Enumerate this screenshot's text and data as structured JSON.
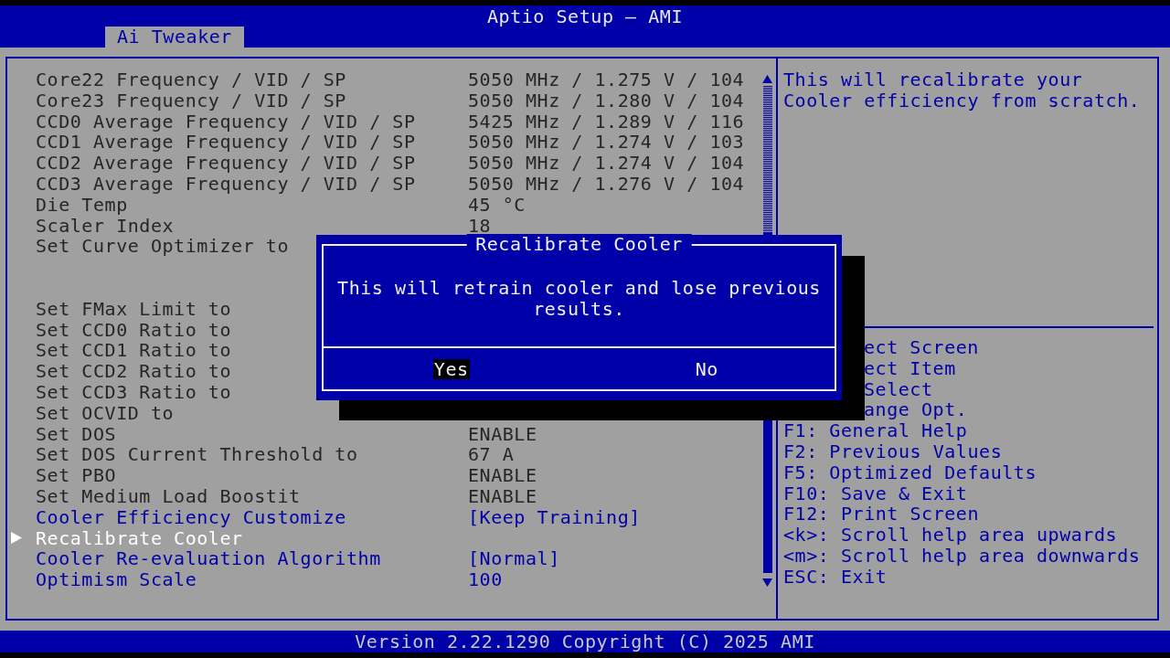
{
  "header": {
    "title": "Aptio Setup – AMI",
    "tabs": [
      {
        "label": "Ai Tweaker",
        "selected": true
      }
    ]
  },
  "rows": [
    {
      "kind": "info",
      "label": "Core22 Frequency / VID / SP",
      "value": "5050 MHz / 1.275 V / 104",
      "selected": false
    },
    {
      "kind": "info",
      "label": "Core23 Frequency / VID / SP",
      "value": "5050 MHz / 1.280 V / 104",
      "selected": false
    },
    {
      "kind": "info",
      "label": "CCD0 Average Frequency / VID / SP",
      "value": "5425 MHz / 1.289 V / 116",
      "selected": false
    },
    {
      "kind": "info",
      "label": "CCD1 Average Frequency / VID / SP",
      "value": "5050 MHz / 1.274 V / 103",
      "selected": false
    },
    {
      "kind": "info",
      "label": "CCD2 Average Frequency / VID / SP",
      "value": "5050 MHz / 1.274 V / 104",
      "selected": false
    },
    {
      "kind": "info",
      "label": "CCD3 Average Frequency / VID / SP",
      "value": "5050 MHz / 1.276 V / 104",
      "selected": false
    },
    {
      "kind": "info",
      "label": "Die Temp",
      "value": "45 °C",
      "selected": false
    },
    {
      "kind": "info",
      "label": "Scaler Index",
      "value": "18",
      "selected": false
    },
    {
      "kind": "info",
      "label": "Set Curve Optimizer to",
      "selected": false
    },
    {
      "kind": "spacer"
    },
    {
      "kind": "spacer"
    },
    {
      "kind": "info",
      "label": "Set FMax Limit to",
      "selected": false
    },
    {
      "kind": "info",
      "label": "Set CCD0 Ratio to",
      "selected": false
    },
    {
      "kind": "info",
      "label": "Set CCD1 Ratio to",
      "selected": false
    },
    {
      "kind": "info",
      "label": "Set CCD2 Ratio to",
      "selected": false
    },
    {
      "kind": "info",
      "label": "Set CCD3 Ratio to",
      "selected": false
    },
    {
      "kind": "info",
      "label": "Set OCVID to",
      "selected": false
    },
    {
      "kind": "info",
      "label": "Set DOS",
      "value": "ENABLE",
      "selected": false
    },
    {
      "kind": "info",
      "label": "Set DOS Current Threshold to",
      "value": "67 A",
      "selected": false
    },
    {
      "kind": "info",
      "label": "Set PBO",
      "value": "ENABLE",
      "selected": false
    },
    {
      "kind": "info",
      "label": "Set Medium Load Boostit",
      "value": "ENABLE",
      "selected": false
    },
    {
      "kind": "option",
      "label": "Cooler Efficiency Customize",
      "value": "[Keep Training]",
      "selected": false
    },
    {
      "kind": "option",
      "label": "Recalibrate Cooler",
      "selected": true
    },
    {
      "kind": "option",
      "label": "Cooler Re-evaluation Algorithm",
      "value": "[Normal]",
      "selected": false
    },
    {
      "kind": "option",
      "label": "Optimism Scale",
      "value": "100",
      "selected": false
    }
  ],
  "help": {
    "lines": [
      "This will recalibrate your",
      "Cooler efficiency from scratch."
    ]
  },
  "keys": [
    {
      "kind": "partial",
      "text": "ect Screen"
    },
    {
      "kind": "partial",
      "text": "ect Item"
    },
    {
      "kind": "partial",
      "text": "Select"
    },
    {
      "kind": "partial",
      "text": "ange Opt."
    },
    {
      "kind": "full",
      "text": "F1: General Help"
    },
    {
      "kind": "full",
      "text": "F2: Previous Values"
    },
    {
      "kind": "full",
      "text": "F5: Optimized Defaults"
    },
    {
      "kind": "full",
      "text": "F10: Save & Exit"
    },
    {
      "kind": "full",
      "text": "F12: Print Screen"
    },
    {
      "kind": "full",
      "text": "<k>: Scroll help area upwards"
    },
    {
      "kind": "full",
      "text": "<m>: Scroll help area downwards"
    },
    {
      "kind": "full",
      "text": "ESC: Exit"
    }
  ],
  "dialog": {
    "title": "Recalibrate Cooler",
    "message": "This will retrain cooler and lose previous results.",
    "buttons": [
      {
        "label": "Yes",
        "selected": true
      },
      {
        "label": "No",
        "selected": false
      }
    ]
  },
  "footer": {
    "text": "Version 2.22.1290 Copyright (C) 2025 AMI"
  }
}
